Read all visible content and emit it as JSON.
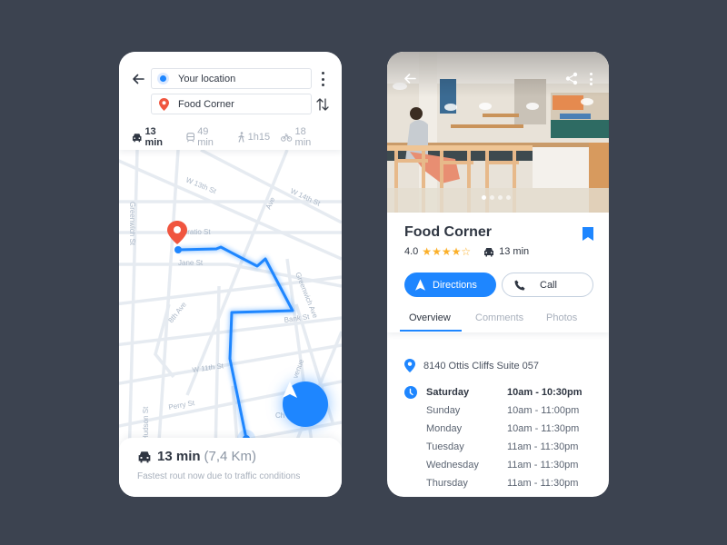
{
  "colors": {
    "background": "#3c4350",
    "accent": "#1e86ff",
    "pin": "#f0553f",
    "star": "#fbb02a",
    "text_primary": "#2f3642",
    "text_muted": "#a8b0bc"
  },
  "map_screen": {
    "from_field": {
      "value": "Your location",
      "icon": "current-location-dot-icon"
    },
    "to_field": {
      "value": "Food Corner",
      "icon": "map-pin-icon"
    },
    "modes": [
      {
        "icon": "car-icon",
        "label": "13 min",
        "active": true
      },
      {
        "icon": "train-icon",
        "label": "49 min",
        "active": false
      },
      {
        "icon": "walk-icon",
        "label": "1h15",
        "active": false
      },
      {
        "icon": "bike-icon",
        "label": "18 min",
        "active": false
      }
    ],
    "streets": {
      "w13": "W 13th St",
      "w14": "W 14th St",
      "ave": "Ave",
      "greenwich_st": "Greenwich St",
      "horatio": "Horatio St",
      "jane": "Jane St",
      "greenwich_ave": "Greenwich Ave",
      "eighth_ave": "8th Ave",
      "bank": "Bank St",
      "w11": "W 11th St",
      "perry": "Perry St",
      "hudson": "Hudson St",
      "avenue": "venue",
      "ch": "Ch"
    },
    "route_card": {
      "icon": "car-icon",
      "time": "13 min",
      "distance": "(7,4 Km)",
      "note": "Fastest rout now due to traffic conditions"
    }
  },
  "detail_screen": {
    "photo_dots": 4,
    "active_photo": 1,
    "name": "Food Corner",
    "rating": "4.0",
    "stars": 4,
    "stars_max": 5,
    "drive_time": "13 min",
    "directions_label": "Directions",
    "call_label": "Call",
    "tabs": [
      {
        "label": "Overview",
        "active": true
      },
      {
        "label": "Comments",
        "active": false
      },
      {
        "label": "Photos",
        "active": false
      }
    ],
    "address": "8140 Ottis Cliffs Suite 057",
    "hours": [
      {
        "day": "Saturday",
        "time": "10am - 10:30pm",
        "today": true
      },
      {
        "day": "Sunday",
        "time": "10am - 11:00pm",
        "today": false
      },
      {
        "day": "Monday",
        "time": "10am - 11:30pm",
        "today": false
      },
      {
        "day": "Tuesday",
        "time": "11am - 11:30pm",
        "today": false
      },
      {
        "day": "Wednesday",
        "time": "11am - 11:30pm",
        "today": false
      },
      {
        "day": "Thursday",
        "time": "11am - 11:30pm",
        "today": false
      }
    ]
  }
}
